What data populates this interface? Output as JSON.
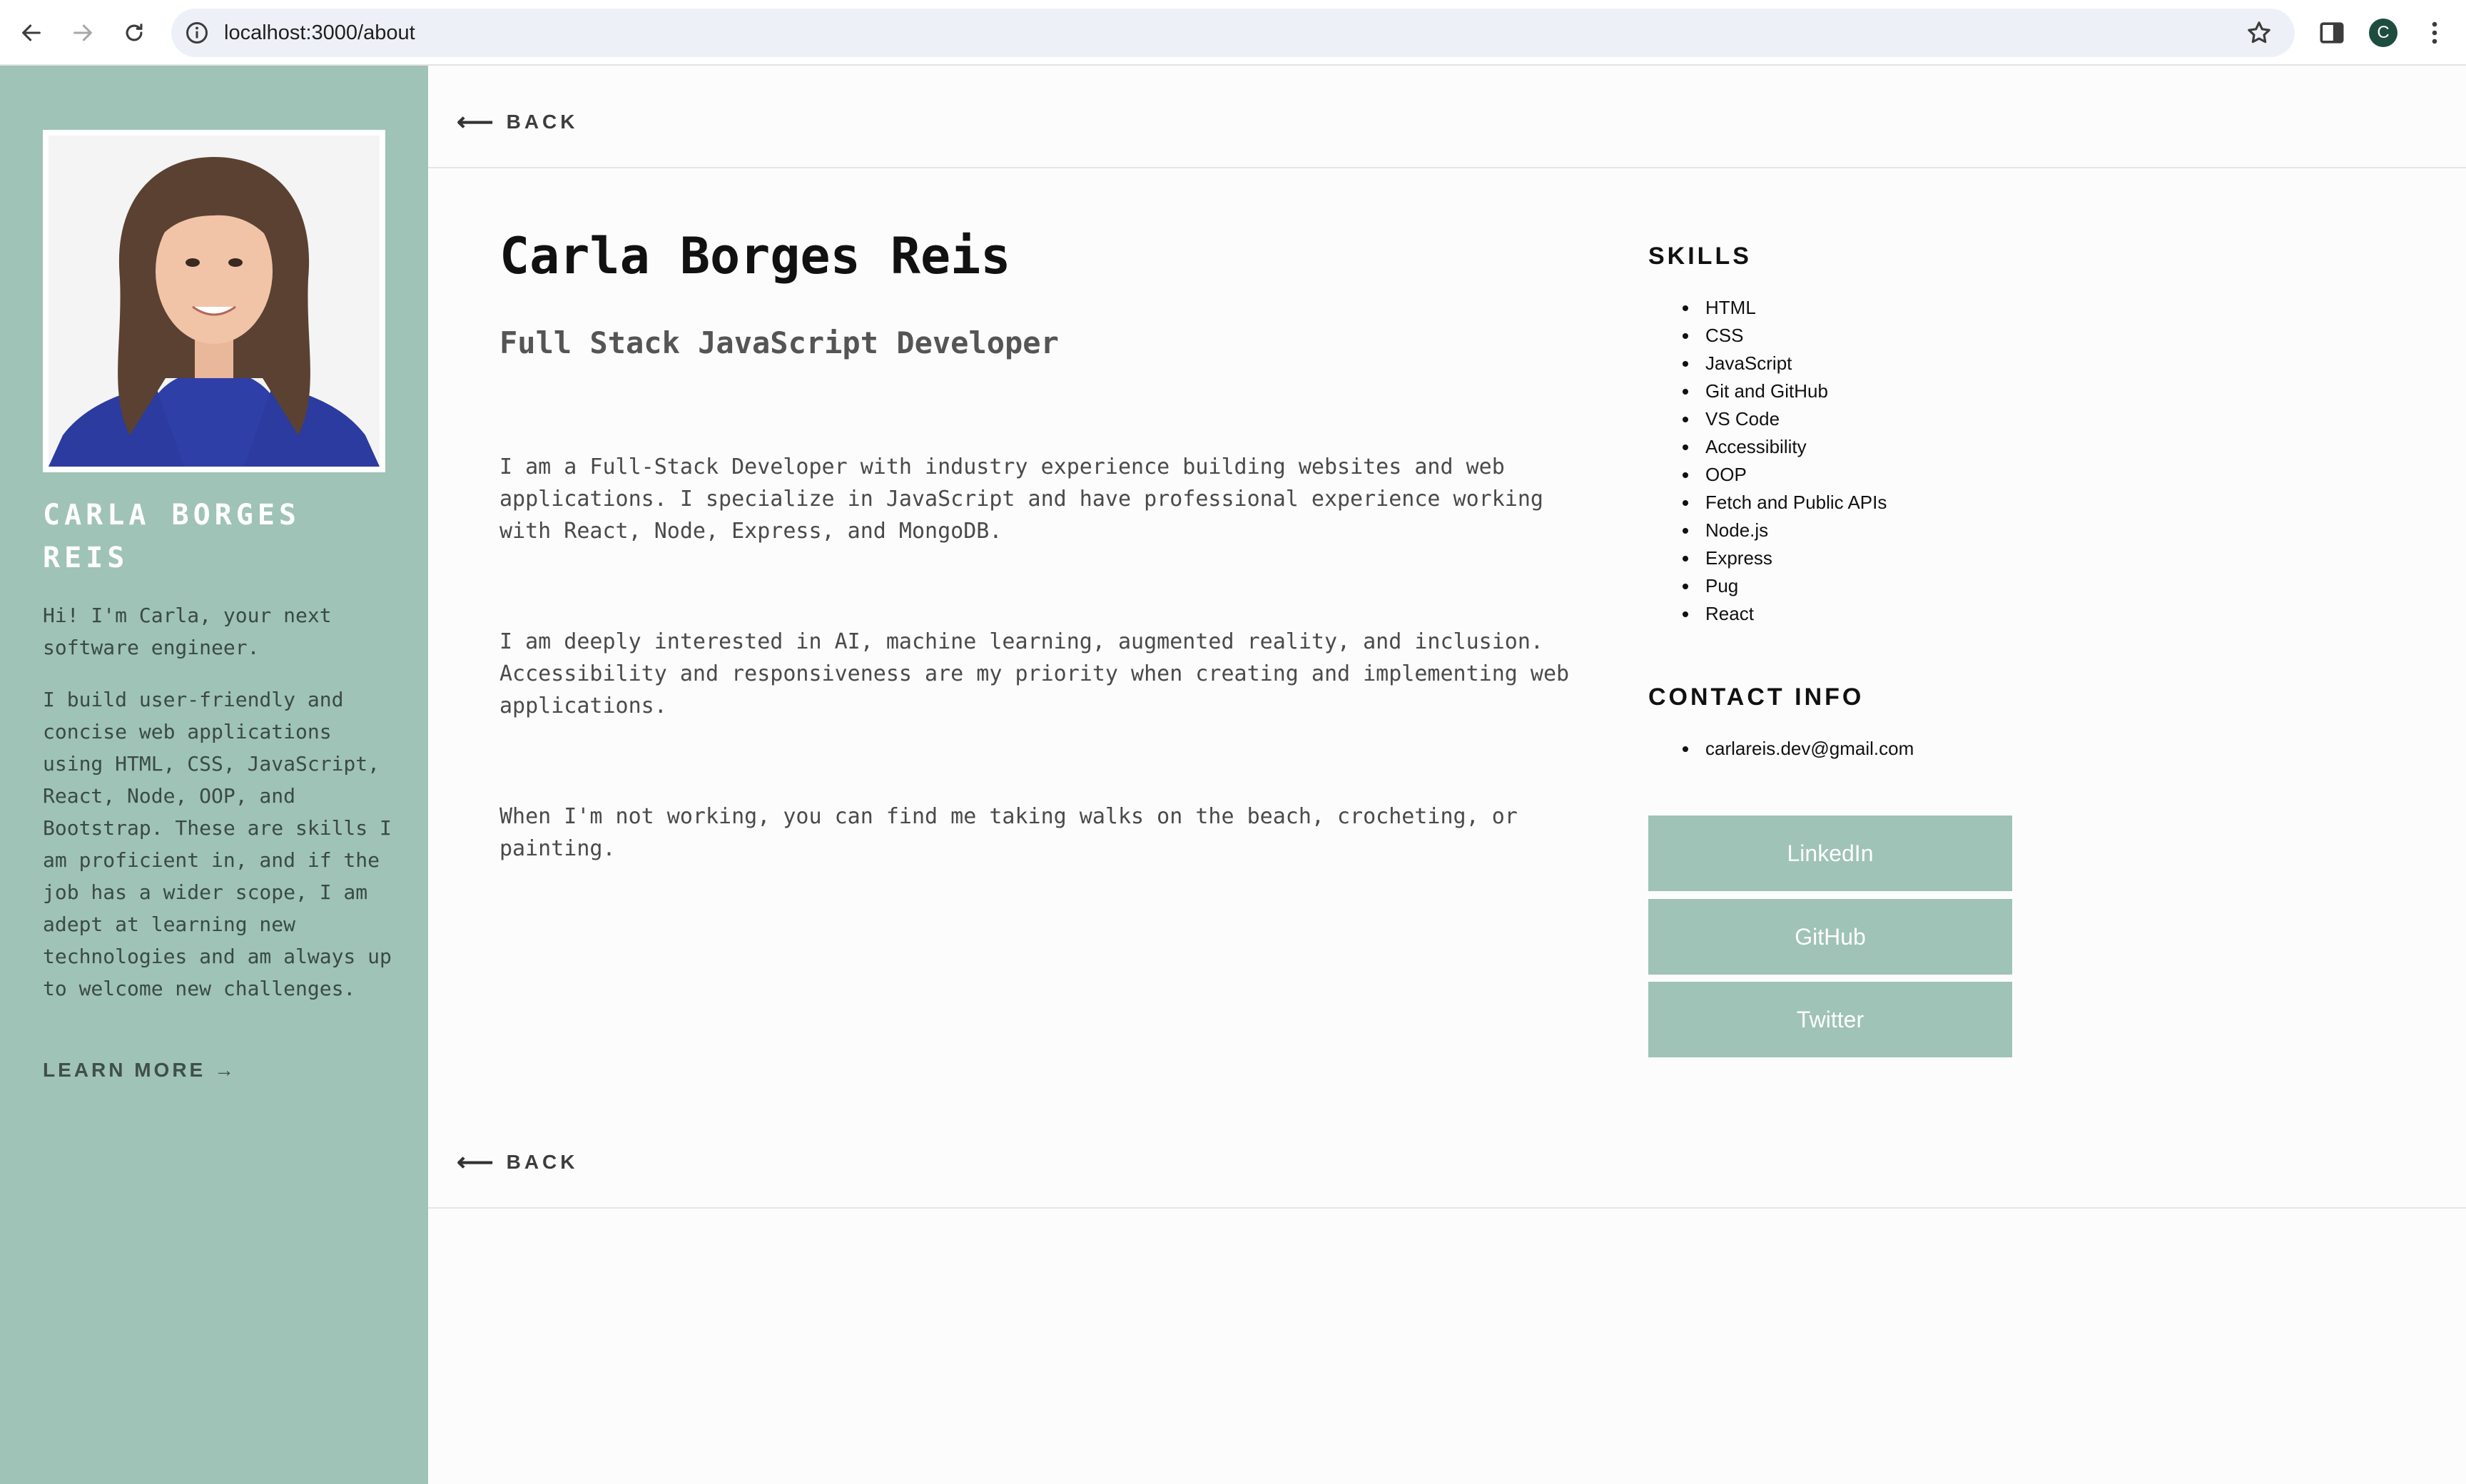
{
  "browser": {
    "url": "localhost:3000/about",
    "profile_initial": "C"
  },
  "sidebar": {
    "name": "CARLA BORGES REIS",
    "intro": "Hi! I'm Carla, your next software engineer.",
    "bio": "I build user-friendly and concise web applications using HTML, CSS, JavaScript, React, Node, OOP, and Bootstrap. These are skills I am proficient in, and if the job has a wider scope, I am adept at learning new technologies and am always up to welcome new challenges.",
    "learn_more": "LEARN MORE →"
  },
  "main": {
    "back_label": "BACK",
    "back_arrow": "⟵",
    "title": "Carla Borges Reis",
    "subtitle": "Full Stack JavaScript Developer",
    "paragraphs": [
      "I am a Full-Stack Developer with industry experience building websites and web applications. I specialize in JavaScript and have professional experience working with React, Node, Express, and MongoDB.",
      "I am deeply interested in AI, machine learning, augmented reality, and inclusion. Accessibility and responsiveness are my priority when creating and implementing web applications.",
      "When I'm not working, you can find me taking walks on the beach, crocheting, or painting."
    ],
    "skills_heading": "SKILLS",
    "skills": [
      "HTML",
      "CSS",
      "JavaScript",
      "Git and GitHub",
      "VS Code",
      "Accessibility",
      "OOP",
      "Fetch and Public APIs",
      "Node.js",
      "Express",
      "Pug",
      "React"
    ],
    "contact_heading": "CONTACT INFO",
    "contact": [
      "carlareis.dev@gmail.com"
    ],
    "social": {
      "linkedin": "LinkedIn",
      "github": "GitHub",
      "twitter": "Twitter"
    }
  },
  "colors": {
    "accent": "#9fc3b6",
    "profile_avatar": "#1e4d3f",
    "page_background": "#fdfcfc"
  },
  "icons": [
    "back-arrow-icon",
    "forward-arrow-icon",
    "reload-icon",
    "site-info-icon",
    "bookmark-star-icon",
    "side-panel-icon",
    "kebab-menu-icon"
  ]
}
